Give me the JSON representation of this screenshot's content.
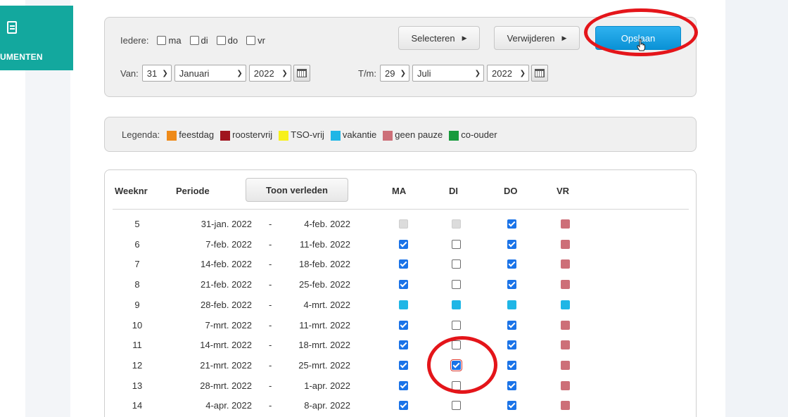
{
  "sidebar": {
    "nav_label": "UMENTEN"
  },
  "filter": {
    "iedere_label": "Iedere:",
    "days": [
      "ma",
      "di",
      "do",
      "vr"
    ],
    "selecteren_label": "Selecteren",
    "verwijderen_label": "Verwijderen",
    "opslaan_label": "Opslaan",
    "van_label": "Van:",
    "van_day": "31",
    "van_month": "Januari",
    "van_year": "2022",
    "tm_label": "T/m:",
    "tm_day": "29",
    "tm_month": "Juli",
    "tm_year": "2022"
  },
  "legend": {
    "label": "Legenda:",
    "items": [
      {
        "label": "feestdag",
        "color": "#ee8a19"
      },
      {
        "label": "roostervrij",
        "color": "#a0141e"
      },
      {
        "label": "TSO-vrij",
        "color": "#f7f01a"
      },
      {
        "label": "vakantie",
        "color": "#1fb6e6"
      },
      {
        "label": "geen pauze",
        "color": "#cd6f78"
      },
      {
        "label": "co-ouder",
        "color": "#179a3c"
      }
    ]
  },
  "table": {
    "headers": {
      "weeknr": "Weeknr",
      "periode": "Periode",
      "toon_verleden": "Toon verleden",
      "ma": "MA",
      "di": "DI",
      "do": "DO",
      "vr": "VR"
    },
    "rows": [
      {
        "week": "5",
        "from": "31-jan. 2022",
        "dash": "-",
        "to": "4-feb. 2022",
        "ma": "disabled",
        "di": "disabled",
        "do": "checked",
        "vr": "nopause"
      },
      {
        "week": "6",
        "from": "7-feb. 2022",
        "dash": "-",
        "to": "11-feb. 2022",
        "ma": "checked",
        "di": "empty",
        "do": "checked",
        "vr": "nopause"
      },
      {
        "week": "7",
        "from": "14-feb. 2022",
        "dash": "-",
        "to": "18-feb. 2022",
        "ma": "checked",
        "di": "empty",
        "do": "checked",
        "vr": "nopause"
      },
      {
        "week": "8",
        "from": "21-feb. 2022",
        "dash": "-",
        "to": "25-feb. 2022",
        "ma": "checked",
        "di": "empty",
        "do": "checked",
        "vr": "nopause"
      },
      {
        "week": "9",
        "from": "28-feb. 2022",
        "dash": "-",
        "to": "4-mrt. 2022",
        "ma": "vacation",
        "di": "vacation",
        "do": "vacation",
        "vr": "vacation"
      },
      {
        "week": "10",
        "from": "7-mrt. 2022",
        "dash": "-",
        "to": "11-mrt. 2022",
        "ma": "checked",
        "di": "empty",
        "do": "checked",
        "vr": "nopause"
      },
      {
        "week": "11",
        "from": "14-mrt. 2022",
        "dash": "-",
        "to": "18-mrt. 2022",
        "ma": "checked",
        "di": "empty",
        "do": "checked",
        "vr": "nopause"
      },
      {
        "week": "12",
        "from": "21-mrt. 2022",
        "dash": "-",
        "to": "25-mrt. 2022",
        "ma": "checked",
        "di": "checked-outlined",
        "do": "checked",
        "vr": "nopause"
      },
      {
        "week": "13",
        "from": "28-mrt. 2022",
        "dash": "-",
        "to": "1-apr. 2022",
        "ma": "checked",
        "di": "empty",
        "do": "checked",
        "vr": "nopause"
      },
      {
        "week": "14",
        "from": "4-apr. 2022",
        "dash": "-",
        "to": "8-apr. 2022",
        "ma": "checked",
        "di": "empty",
        "do": "checked",
        "vr": "nopause"
      }
    ]
  },
  "colors": {
    "accent": "#13a89e",
    "primary_button": "#1a9fe0",
    "annotation": "#e4151a"
  }
}
